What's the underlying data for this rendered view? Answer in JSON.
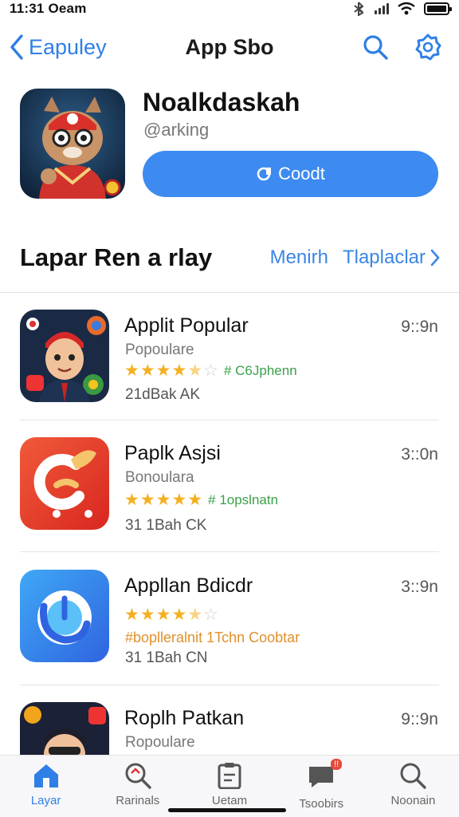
{
  "status_bar": {
    "time": "11:31 Oeam"
  },
  "nav": {
    "back_label": "Eapuley",
    "title": "App Sbo",
    "icons": [
      "search-icon",
      "gear-icon"
    ]
  },
  "hero": {
    "name": "Noalkdaskah",
    "subtitle": "@arking",
    "button_label": "Coodt"
  },
  "section": {
    "title": "Lapar Ren a rlay",
    "link_1": "Menirh",
    "link_2": "Tlaplaclar"
  },
  "apps": [
    {
      "name": "Applit Popular",
      "time": "9::9n",
      "category": "Popoulare",
      "stars": 4.5,
      "tag": "# C6Jphenn",
      "size": "21dBak AK"
    },
    {
      "name": "Paplk Asjsi",
      "time": "3::0n",
      "category": "Bonoulara",
      "stars": 5,
      "tag": "# 1opslnatn",
      "size": "31 1Bah CK"
    },
    {
      "name": "Appllan Bdicdr",
      "time": "3::9n",
      "stars": 4.5,
      "promo": "#boplleralnit 1Tchn Coobtar",
      "size": "31 1Bah CN"
    },
    {
      "name": "Roplh Patkan",
      "time": "9::9n",
      "category": "Ropoulare"
    }
  ],
  "tabbar": [
    {
      "label": "Layar",
      "icon": "house-icon",
      "active": true
    },
    {
      "label": "Rarinals",
      "icon": "search-icon"
    },
    {
      "label": "Uetam",
      "icon": "clipboard-icon"
    },
    {
      "label": "Tsoobirs",
      "icon": "chat-icon",
      "badge": "!!"
    },
    {
      "label": "Noonain",
      "icon": "search-icon"
    }
  ],
  "colors": {
    "accent": "#3d8bf0",
    "star": "#f4b01e",
    "tag_green": "#3aa04a",
    "promo_orange": "#e0902a"
  }
}
